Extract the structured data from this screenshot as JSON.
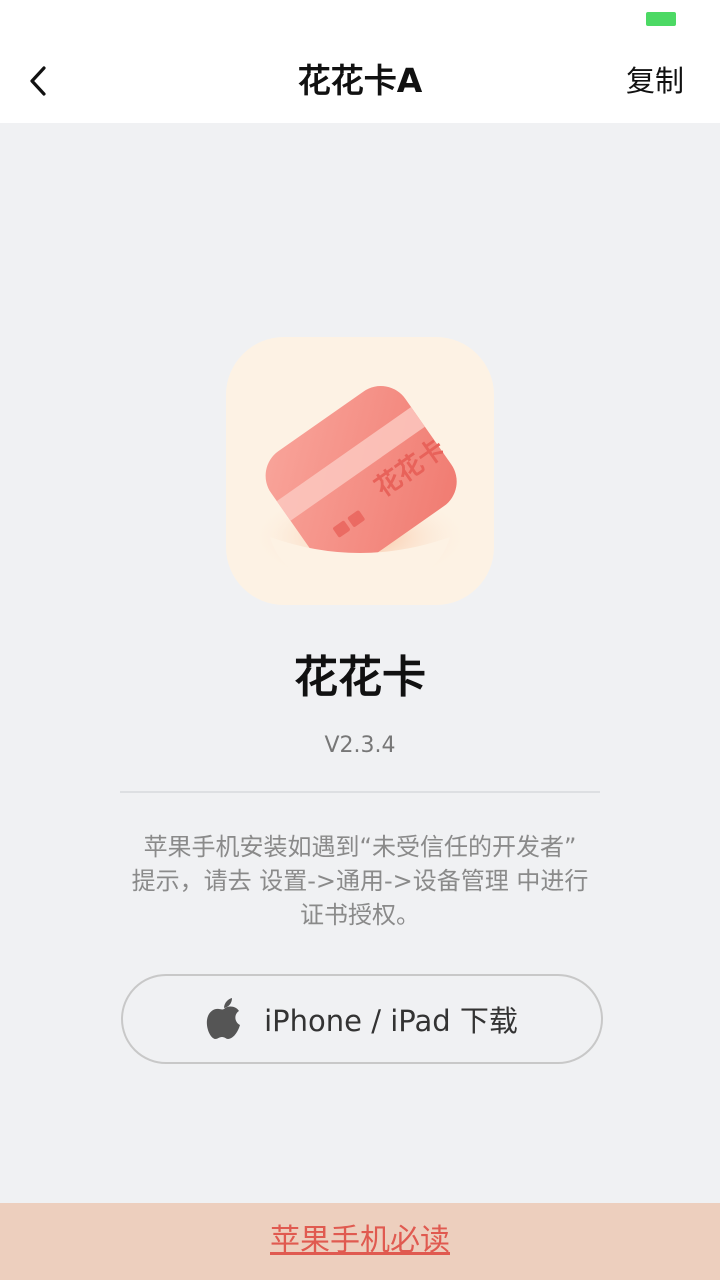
{
  "nav": {
    "title": "花花卡A",
    "copy_label": "复制"
  },
  "app": {
    "name": "花花卡",
    "version": "V2.3.4",
    "icon_card_text": "花花卡"
  },
  "notice": {
    "line1": "苹果手机安装如遇到“未受信任的开发者”",
    "line2": "提示，请去 设置->通用->设备管理 中进行",
    "line3": "证书授权。"
  },
  "download": {
    "label": "iPhone / iPad 下载",
    "icon": "apple-icon"
  },
  "footer": {
    "link_label": "苹果手机必读"
  },
  "colors": {
    "battery": "#4cd964",
    "icon_bg": "#fdf2e4",
    "card": "#f4887e",
    "footer_bg": "#edcfbe",
    "footer_link": "#e05a50"
  }
}
